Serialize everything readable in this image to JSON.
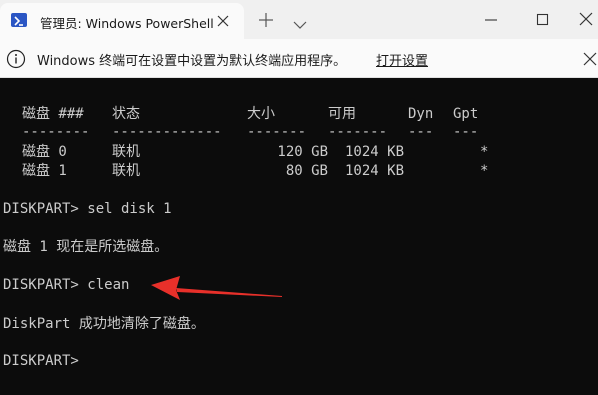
{
  "window": {
    "tab_title": "管理员: Windows PowerShell",
    "icons": {
      "tab": "powershell-icon",
      "close_tab": "close-icon",
      "new_tab": "plus-icon",
      "dropdown": "chevron-down-icon",
      "minimize": "minimize-icon",
      "maximize": "maximize-icon",
      "close": "close-icon"
    }
  },
  "infobar": {
    "message": "Windows 终端可在设置中设置为默认终端应用程序。",
    "link": "打开设置",
    "icon": "info-icon"
  },
  "terminal": {
    "header": {
      "disk": "磁盘 ###",
      "status": "状态",
      "size": "大小",
      "free": "可用",
      "dyn": "Dyn",
      "gpt": "Gpt"
    },
    "separators": {
      "disk": "--------",
      "status": "-------------",
      "size": "-------",
      "free": "-------",
      "dyn": "---",
      "gpt": "---"
    },
    "disks": [
      {
        "disk": "磁盘 0",
        "status": "联机",
        "size": "120 GB",
        "free": "1024 KB",
        "dyn": "",
        "gpt": "*"
      },
      {
        "disk": "磁盘 1",
        "status": "联机",
        "size": "80 GB",
        "free": "1024 KB",
        "dyn": "",
        "gpt": "*"
      }
    ],
    "lines": {
      "cmd1": "DISKPART> sel disk 1",
      "out1": "磁盘 1 现在是所选磁盘。",
      "cmd2": "DISKPART> clean",
      "out2": "DiskPart 成功地清除了磁盘。",
      "prompt": "DISKPART>"
    },
    "colors": {
      "background": "#0c0c0c",
      "text": "#cccccc",
      "annotation_arrow": "#e8302a"
    }
  }
}
